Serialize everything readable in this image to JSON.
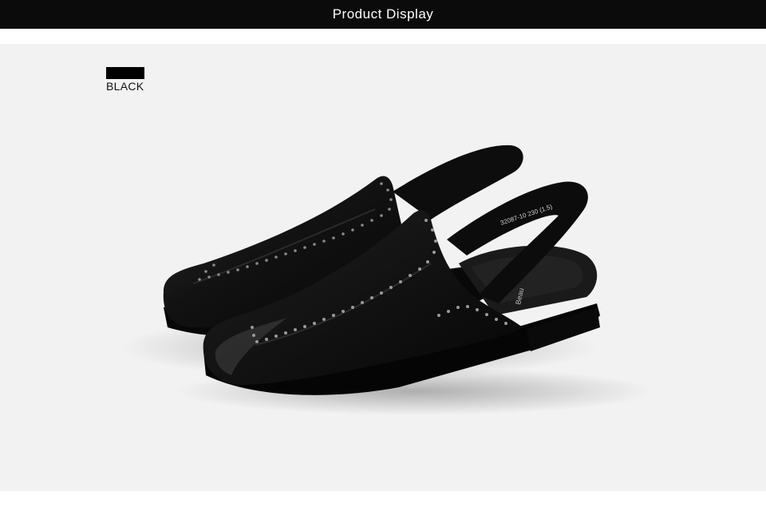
{
  "header": {
    "title": "Product Display"
  },
  "swatch": {
    "label": "BLACK",
    "color": "#000000"
  },
  "product": {
    "insole_text": "32087-10  230  (1.5)",
    "insole_brand": "Beau"
  },
  "colors": {
    "title_bar": "#0b0b0b",
    "background": "#f2f2f2",
    "leather": "#141414"
  }
}
